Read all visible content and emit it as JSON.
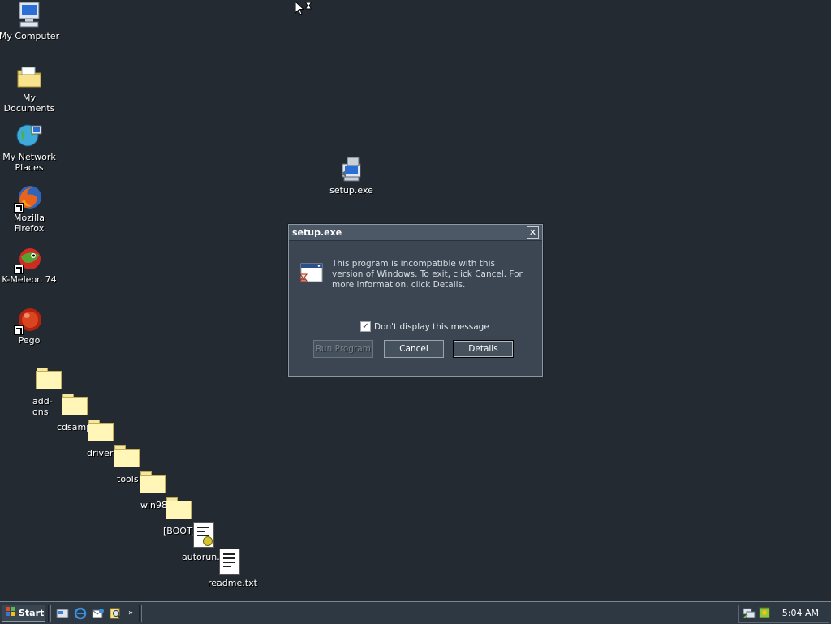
{
  "desktop": {
    "icons": [
      {
        "label": "My Computer"
      },
      {
        "label": "My Documents"
      },
      {
        "label": "My Network Places"
      },
      {
        "label": "Mozilla Firefox"
      },
      {
        "label": "K-Meleon 74"
      },
      {
        "label": "Pego"
      }
    ],
    "setup_icon_label": "setup.exe",
    "files": [
      {
        "label": "add-ons"
      },
      {
        "label": "cdsample"
      },
      {
        "label": "drivers"
      },
      {
        "label": "tools"
      },
      {
        "label": "win98"
      },
      {
        "label": "[BOOT]"
      },
      {
        "label": "autorun.inf"
      },
      {
        "label": "readme.txt"
      }
    ]
  },
  "dialog": {
    "title": "setup.exe",
    "close_glyph": "✕",
    "message": "This program is incompatible with this version of Windows.  To exit, click Cancel.  For more information, click Details.",
    "checkbox_label": "Don't display this message",
    "checkbox_checked": true,
    "buttons": {
      "run": "Run Program",
      "cancel": "Cancel",
      "details": "Details"
    }
  },
  "taskbar": {
    "start_label": "Start",
    "quicklaunch_icons": [
      "desktop-icon",
      "ie-icon",
      "outlook-icon",
      "search-icon"
    ],
    "chevron": "»",
    "clock": "5:04 AM"
  },
  "colors": {
    "desktop_bg": "#232a31",
    "dialog_bg": "#3c4652",
    "taskbar_bg": "#2e3843"
  }
}
